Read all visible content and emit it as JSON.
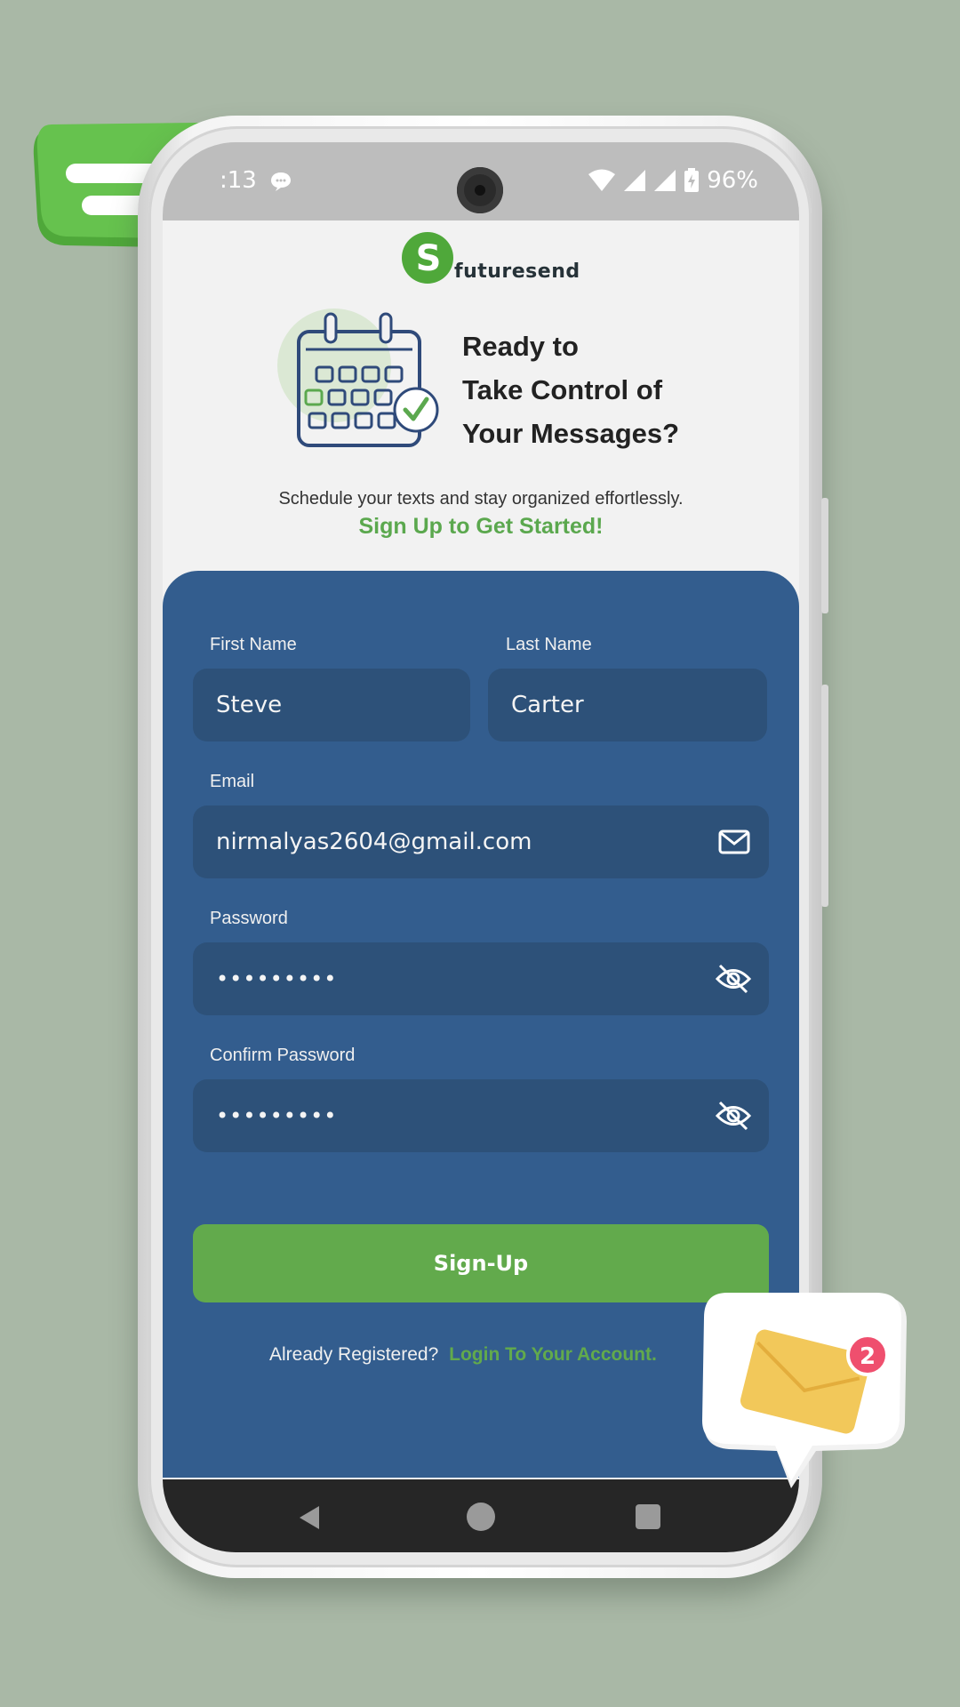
{
  "status_bar": {
    "time": ":13",
    "battery": "96%"
  },
  "brand": {
    "logo_text": "futuresend",
    "logo_letter": "S"
  },
  "hero": {
    "title_lines": [
      "Ready to",
      "Take Control of",
      "Your Messages?"
    ],
    "subtitle": "Schedule your texts and stay organized effortlessly.",
    "cta": "Sign Up to Get Started!"
  },
  "form": {
    "first_name": {
      "label": "First Name",
      "value": "Steve"
    },
    "last_name": {
      "label": "Last Name",
      "value": "Carter"
    },
    "email": {
      "label": "Email",
      "value": "nirmalyas2604@gmail.com"
    },
    "password": {
      "label": "Password",
      "value": "•••••••••"
    },
    "confirm_password": {
      "label": "Confirm Password",
      "value": "•••••••••"
    },
    "submit_label": "Sign-Up",
    "login_prompt": "Already Registered?",
    "login_link": "Login To Your Account."
  },
  "decorations": {
    "mail_badge_count": "2"
  },
  "colors": {
    "background": "#a9b8a6",
    "card": "#335d8e",
    "input": "#2d5179",
    "accent_green": "#62aa4c"
  },
  "icons": [
    "message-icon",
    "wifi-icon",
    "signal-icon",
    "battery-icon",
    "calendar-icon",
    "mail-icon",
    "eye-off-icon",
    "back-icon",
    "home-icon",
    "recent-apps-icon"
  ]
}
